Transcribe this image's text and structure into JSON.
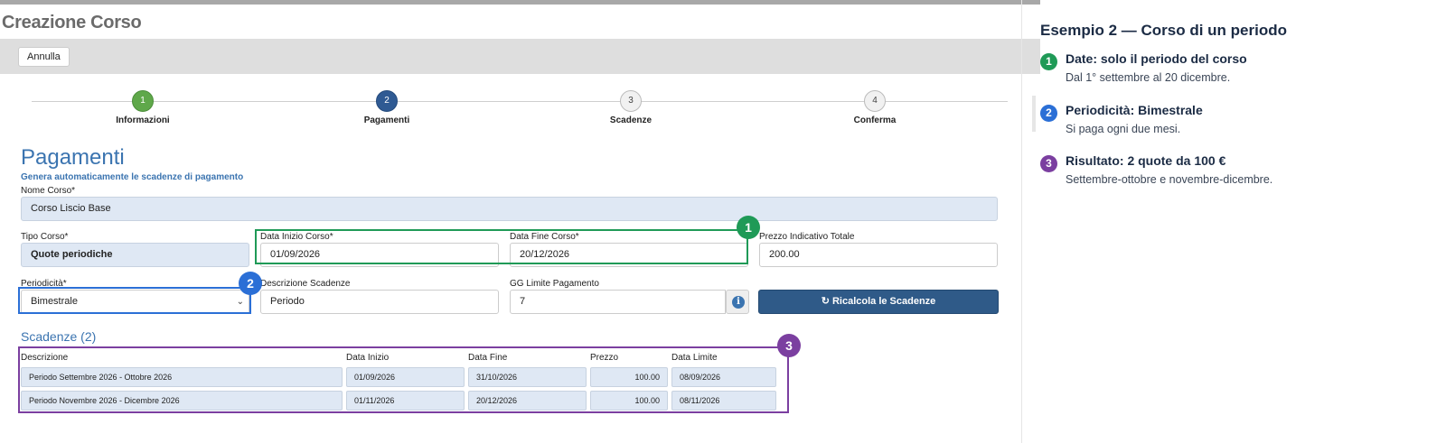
{
  "page": {
    "title": "Creazione Corso",
    "cancel_label": "Annulla"
  },
  "wizard": {
    "steps": [
      {
        "num": "1",
        "label": "Informazioni",
        "state": "done"
      },
      {
        "num": "2",
        "label": "Pagamenti",
        "state": "active"
      },
      {
        "num": "3",
        "label": "Scadenze",
        "state": "todo"
      },
      {
        "num": "4",
        "label": "Conferma",
        "state": "todo"
      }
    ]
  },
  "section": {
    "title": "Pagamenti",
    "subtitle": "Genera automaticamente le scadenze di pagamento"
  },
  "form": {
    "nome_corso": {
      "label": "Nome Corso*",
      "value": "Corso Liscio Base"
    },
    "tipo_corso": {
      "label": "Tipo Corso*",
      "value": "Quote periodiche"
    },
    "data_inizio": {
      "label": "Data Inizio Corso*",
      "value": "01/09/2026"
    },
    "data_fine": {
      "label": "Data Fine Corso*",
      "value": "20/12/2026"
    },
    "prezzo_totale": {
      "label": "Prezzo Indicativo Totale",
      "value": "200.00"
    },
    "periodicita": {
      "label": "Periodicità*",
      "value": "Bimestrale"
    },
    "descrizione_scadenze": {
      "label": "Descrizione Scadenze",
      "value": "Periodo"
    },
    "gg_limite": {
      "label": "GG Limite Pagamento",
      "value": "7"
    },
    "info_icon": "i",
    "recalc_label": "↻ Ricalcola le Scadenze"
  },
  "scadenze": {
    "title": "Scadenze (2)",
    "columns": [
      "Descrizione",
      "Data Inizio",
      "Data Fine",
      "Prezzo",
      "Data Limite"
    ],
    "rows": [
      [
        "Periodo Settembre 2026 - Ottobre 2026",
        "01/09/2026",
        "31/10/2026",
        "100.00",
        "08/09/2026"
      ],
      [
        "Periodo Novembre 2026 - Dicembre 2026",
        "01/11/2026",
        "20/12/2026",
        "100.00",
        "08/11/2026"
      ]
    ]
  },
  "callouts": {
    "badge_1": "1",
    "badge_2": "2",
    "badge_3": "3"
  },
  "panel": {
    "title": "Esempio 2 — Corso di un periodo",
    "notes": [
      {
        "num": "1",
        "heading": "Date: solo il periodo del corso",
        "body": "Dal 1° settembre al 20 dicembre."
      },
      {
        "num": "2",
        "heading": "Periodicità: Bimestrale",
        "body": "Si paga ogni due mesi."
      },
      {
        "num": "3",
        "heading": "Risultato: 2 quote da 100 €",
        "body": "Settembre-ottobre e novembre-dicembre."
      }
    ]
  },
  "colors": {
    "green": "#1f9a57",
    "blue": "#2b6fd6",
    "purple": "#7b3fa0",
    "accent": "#3b74b0",
    "button": "#2f5a88"
  }
}
